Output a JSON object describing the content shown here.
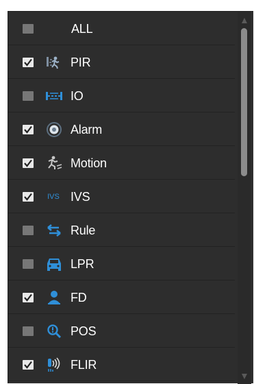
{
  "colors": {
    "panel_bg": "#2d2d2d",
    "row_divider": "#222222",
    "text": "#ffffff",
    "icon_blue": "#2f8fd8",
    "checkbox_checked": "#e8e8e8",
    "checkbox_unchecked": "#777777"
  },
  "items": [
    {
      "label": "ALL",
      "checked": false,
      "icon": "none"
    },
    {
      "label": "PIR",
      "checked": true,
      "icon": "pir-icon"
    },
    {
      "label": "IO",
      "checked": false,
      "icon": "io-icon"
    },
    {
      "label": "Alarm",
      "checked": true,
      "icon": "alarm-icon"
    },
    {
      "label": "Motion",
      "checked": true,
      "icon": "motion-icon"
    },
    {
      "label": "IVS",
      "checked": true,
      "icon": "ivs-icon",
      "icon_text": "IVS"
    },
    {
      "label": "Rule",
      "checked": false,
      "icon": "rule-icon"
    },
    {
      "label": "LPR",
      "checked": false,
      "icon": "car-icon"
    },
    {
      "label": "FD",
      "checked": true,
      "icon": "person-icon"
    },
    {
      "label": "POS",
      "checked": false,
      "icon": "magnifier-icon"
    },
    {
      "label": "FLIR",
      "checked": true,
      "icon": "thermal-icon"
    }
  ]
}
